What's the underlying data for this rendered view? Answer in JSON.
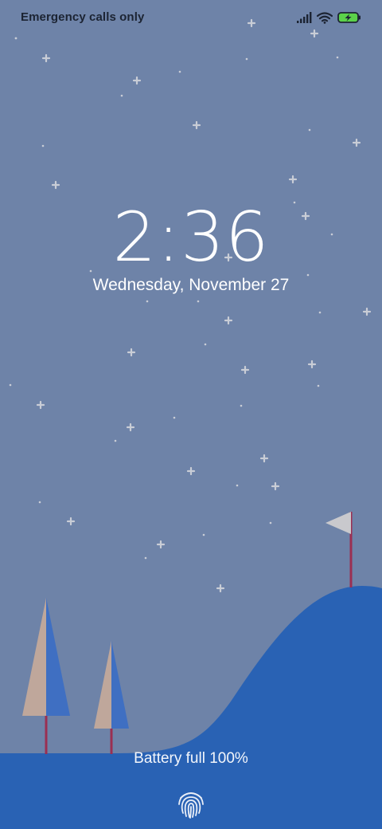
{
  "status_bar": {
    "carrier_text": "Emergency calls only",
    "icons": [
      "signal-icon",
      "wifi-icon",
      "battery-charging-icon"
    ],
    "battery_color": "#5bd24a"
  },
  "lock_screen": {
    "time": "2:36",
    "date": "Wednesday, November 27",
    "battery_message": "Battery full 100%"
  },
  "wallpaper": {
    "sky_color": "#6e83a8",
    "hill_color": "#2962b4",
    "star_color": "#c9cdd6",
    "tree_colors": {
      "left_half": "#bfa79b",
      "right_half": "#3f6fc2",
      "trunk": "#9b2f52"
    },
    "flag_colors": {
      "flag": "#c9c9cd",
      "pole": "#9b2f52"
    }
  },
  "bottom": {
    "unlock_icon": "fingerprint-icon"
  }
}
